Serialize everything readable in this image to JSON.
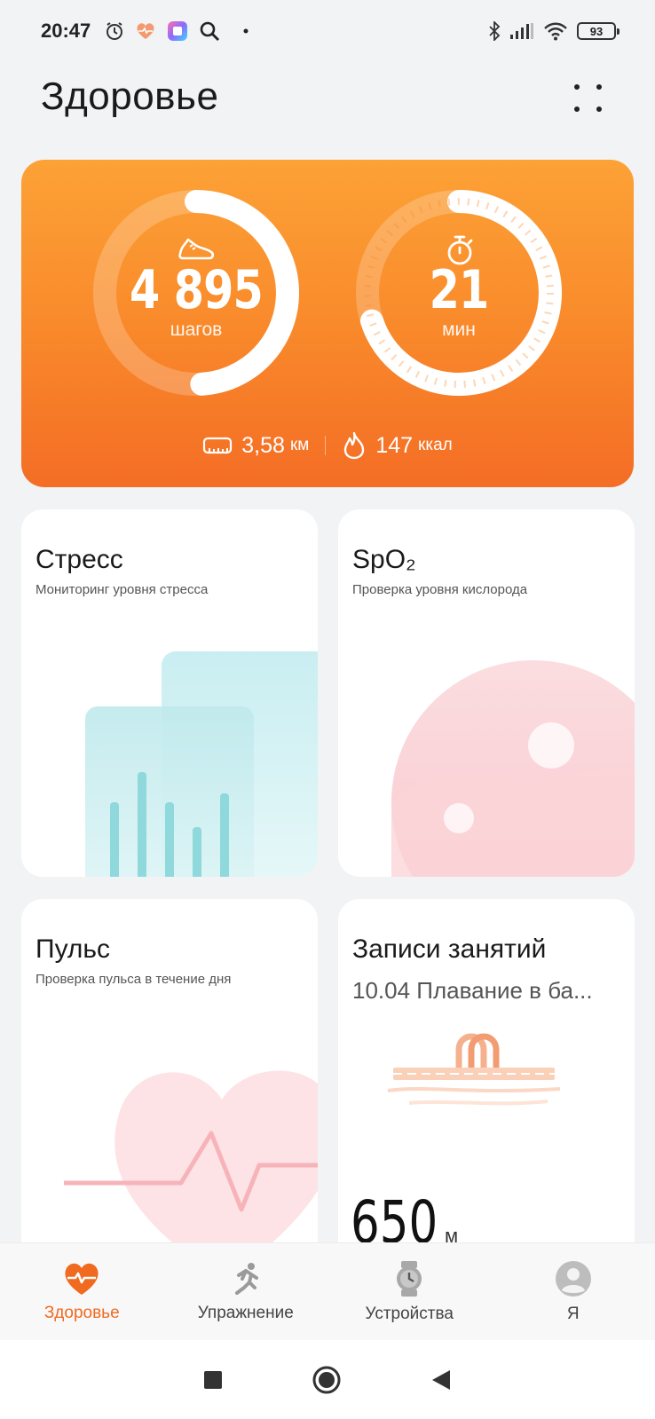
{
  "status_bar": {
    "time": "20:47",
    "battery": "93",
    "icons": [
      "alarm-icon",
      "health-app-icon",
      "gallery-app-icon",
      "search-icon",
      "dot-icon",
      "bluetooth-icon",
      "signal-icon",
      "wifi-icon",
      "battery-icon"
    ]
  },
  "header": {
    "title": "Здоровье",
    "menu_icon": "grid-dots-icon"
  },
  "activity": {
    "steps_value": "4 895",
    "steps_unit": "шагов",
    "steps_progress": 0.49,
    "minutes_value": "21",
    "minutes_unit": "мин",
    "minutes_progress": 0.7,
    "distance_value": "3,58",
    "distance_unit": "км",
    "calories_value": "147",
    "calories_unit": "ккал",
    "colors": {
      "start": "#fca236",
      "end": "#f46d25"
    }
  },
  "tiles": {
    "stress": {
      "title": "Стресс",
      "subtitle": "Мониторинг уровня стресса"
    },
    "spo2": {
      "title": "SpO₂",
      "subtitle": "Проверка уровня кислорода"
    },
    "pulse": {
      "title": "Пульс",
      "subtitle": "Проверка пульса в течение дня"
    },
    "workouts": {
      "title": "Записи занятий",
      "subtitle": "10.04 Плавание в ба...",
      "value": "650",
      "unit": "м"
    }
  },
  "bottom_nav": [
    {
      "label": "Здоровье",
      "icon": "heart-pulse-icon",
      "active": true
    },
    {
      "label": "Упражнение",
      "icon": "running-icon",
      "active": false
    },
    {
      "label": "Устройства",
      "icon": "watch-icon",
      "active": false
    },
    {
      "label": "Я",
      "icon": "profile-icon",
      "active": false
    }
  ],
  "accent_color": "#f06a20"
}
